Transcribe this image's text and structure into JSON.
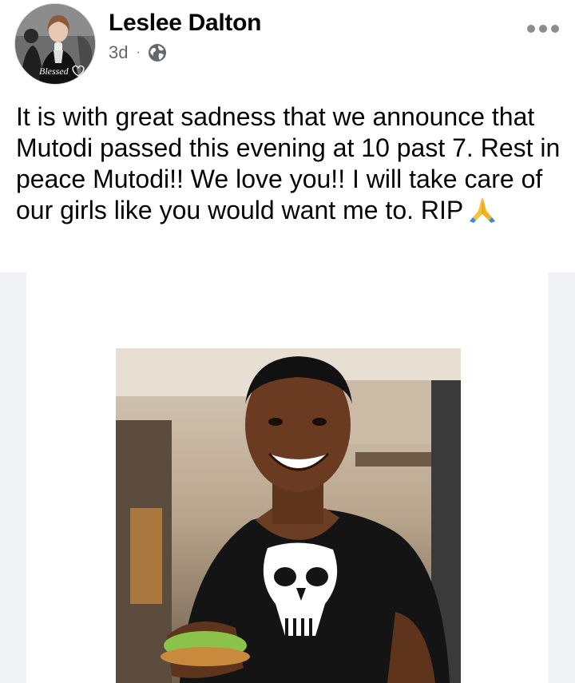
{
  "post": {
    "author": "Leslee Dalton",
    "time": "3d",
    "separator": "·",
    "privacy_icon": "globe-icon",
    "more_icon": "more-options-icon",
    "text": "It is with great sadness that we announce that Mutodi passed this evening at 10 past 7. Rest in peace Mutodi!! We love you!! I will take care of our girls like you would want me to. RIP",
    "emoji": "folded-hands-emoji"
  },
  "avatar": {
    "caption": "Blessed"
  },
  "colors": {
    "text": "#050505",
    "meta": "#65676b",
    "photo_background": "#f0f2f5"
  }
}
